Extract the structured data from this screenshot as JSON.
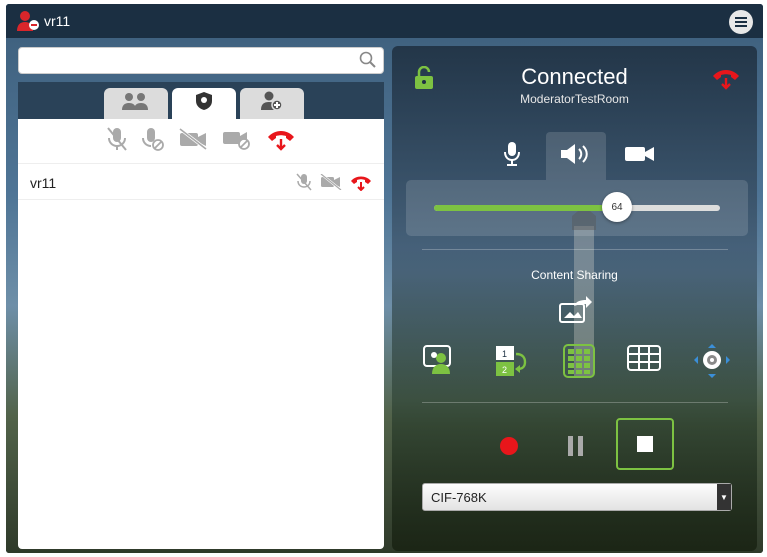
{
  "window": {
    "title": "vr11",
    "icons": {
      "user": "user-remove-icon",
      "menu": "hamburger-menu-icon"
    }
  },
  "search": {
    "value": "",
    "placeholder": ""
  },
  "tabs": [
    {
      "icon": "participants-icon",
      "active": false
    },
    {
      "icon": "moderator-badge-icon",
      "active": true
    },
    {
      "icon": "add-user-icon",
      "active": false
    }
  ],
  "moderation_controls": [
    "mute-all-mic-icon",
    "mute-all-mic-soft-icon",
    "mute-all-video-icon",
    "mute-all-video-soft-icon",
    "disconnect-all-icon"
  ],
  "participants": [
    {
      "name": "vr11",
      "icons": [
        "mic-muted-icon",
        "video-muted-icon",
        "hangup-icon"
      ]
    }
  ],
  "call": {
    "status": "Connected",
    "room": "ModeratorTestRoom",
    "lock_icon": "lock-open-icon",
    "hangup_icon": "hangup-icon"
  },
  "media_tabs": [
    "microphone-icon",
    "speaker-icon",
    "camera-icon"
  ],
  "volume": {
    "value": 64,
    "max": 100
  },
  "content_sharing": {
    "label": "Content Sharing",
    "icon": "share-screen-icon"
  },
  "layouts": [
    "self-view-icon",
    "swap-layout-icon",
    "grid-layout-icon",
    "table-layout-icon",
    "camera-control-icon"
  ],
  "recording": {
    "record_icon": "record-icon",
    "pause_icon": "pause-icon",
    "stop_icon": "stop-icon"
  },
  "quality": {
    "selected": "CIF-768K"
  },
  "colors": {
    "accent_green": "#7dc242",
    "hangup_red": "#e8161b",
    "titlebar": "#1b2f42"
  }
}
